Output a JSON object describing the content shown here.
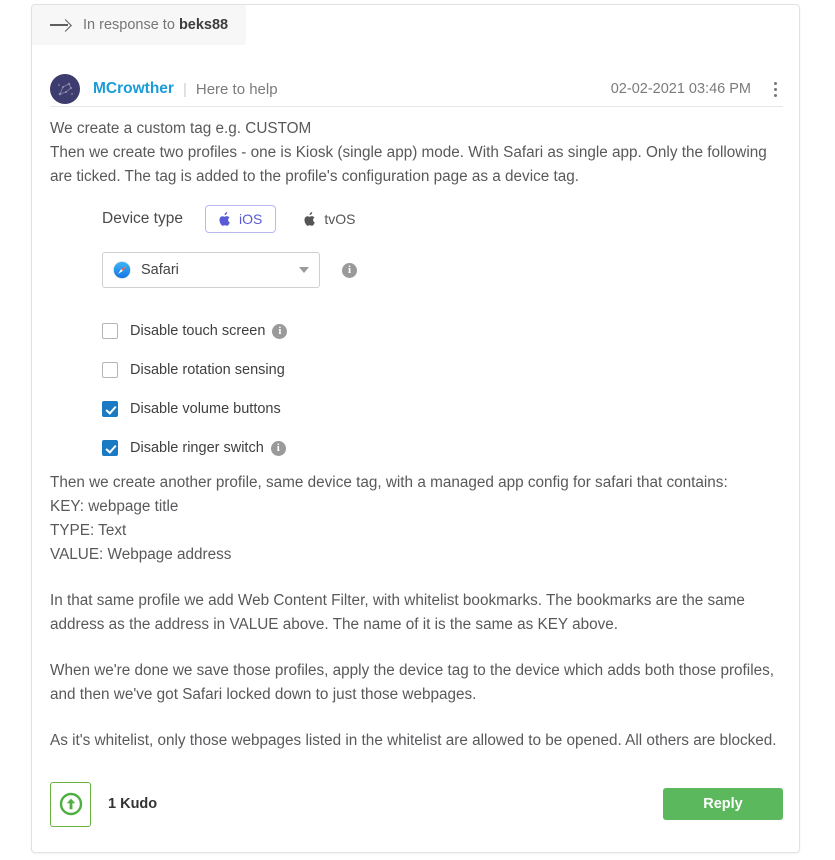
{
  "colors": {
    "username": "#1b9cd8",
    "checkbox_checked": "#1b7ac4",
    "ios_accent": "#5a5ad6",
    "kudo_green": "#6cb33f",
    "reply_green": "#5cb85c",
    "avatar": "#3c3c6e",
    "body_text": "#58595b"
  },
  "response_banner": {
    "icon": "arrow-right-icon",
    "prefix": "In response to",
    "user": "beks88"
  },
  "post_header": {
    "avatar_icon": "user-avatar",
    "author": "MCrowther",
    "separator": "|",
    "rank": "Here to help",
    "timestamp": "02-02-2021 03:46 PM",
    "options_icon": "kebab-menu-icon"
  },
  "post_body": {
    "intro_lines": [
      "We create a custom tag e.g. CUSTOM",
      "Then we create two profiles - one is Kiosk (single app) mode. With Safari as single app. Only the following are ticked. The tag is added to the profile's configuration page as a device tag."
    ],
    "after_form_lines": [
      "Then we create another profile, same device tag, with a managed app config for safari that contains:",
      "KEY: webpage title",
      "TYPE: Text",
      "VALUE: Webpage address"
    ],
    "paragraph_3": "In that same profile we add Web Content Filter, with whitelist bookmarks. The bookmarks are the same address as the address in VALUE above. The name of it is the same as KEY above.",
    "paragraph_4": "When we're done we save those profiles, apply the device tag to the device which adds both those profiles, and then we've got Safari locked down to just those webpages.",
    "paragraph_5": "As it's whitelist, only those webpages listed in the whitelist are allowed to be opened. All others are blocked."
  },
  "form": {
    "device_type_label": "Device type",
    "device_options": [
      {
        "label": "iOS",
        "icon": "apple-icon",
        "selected": true
      },
      {
        "label": "tvOS",
        "icon": "apple-icon",
        "selected": false
      }
    ],
    "app_select": {
      "icon": "safari-icon",
      "value": "Safari",
      "caret_icon": "chevron-down-icon",
      "info_icon": "info-icon",
      "info_glyph": "i"
    },
    "checkboxes": [
      {
        "label": "Disable touch screen",
        "checked": false,
        "has_info": true
      },
      {
        "label": "Disable rotation sensing",
        "checked": false,
        "has_info": false
      },
      {
        "label": "Disable volume buttons",
        "checked": true,
        "has_info": false
      },
      {
        "label": "Disable ringer switch",
        "checked": true,
        "has_info": true
      }
    ]
  },
  "footer": {
    "kudo_icon": "kudos-up-arrow-icon",
    "kudo_count": "1 Kudo",
    "reply_label": "Reply"
  }
}
